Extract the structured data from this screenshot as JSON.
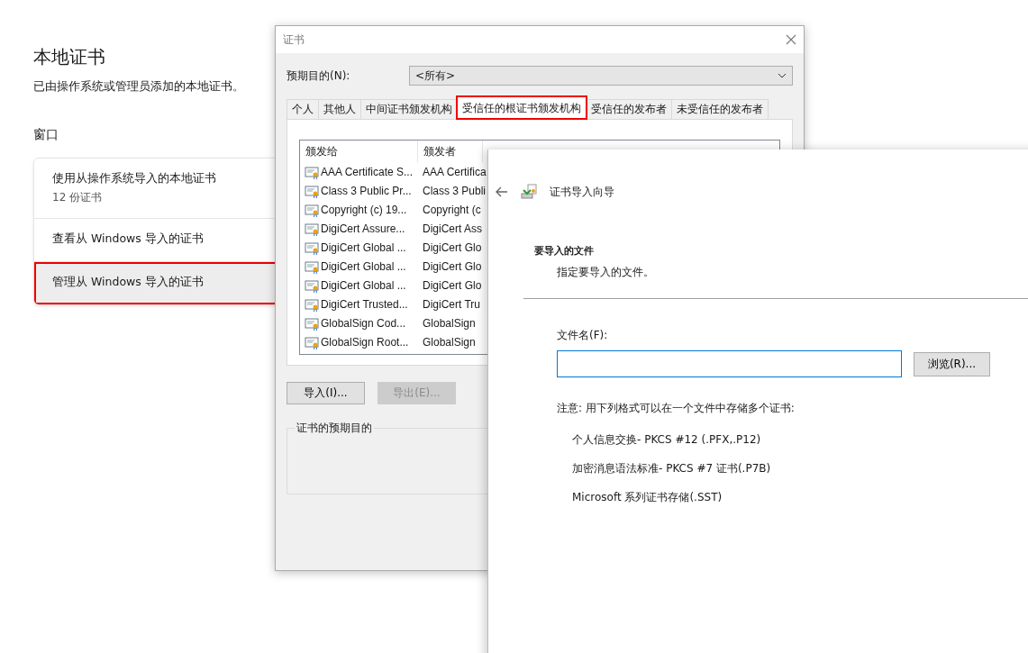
{
  "settings": {
    "title": "本地证书",
    "description": "已由操作系统或管理员添加的本地证书。",
    "section": "窗口",
    "items": [
      {
        "label": "使用从操作系统导入的本地证书",
        "sublabel": "12 份证书",
        "highlighted": false
      },
      {
        "label": "查看从 Windows 导入的证书",
        "highlighted": false
      },
      {
        "label": "管理从 Windows 导入的证书",
        "highlighted": true
      }
    ]
  },
  "cert_dialog": {
    "title": "证书",
    "purpose_label": "预期目的(N):",
    "purpose_value": "<所有>",
    "tabs": [
      {
        "label": "个人",
        "selected": false,
        "highlighted": false
      },
      {
        "label": "其他人",
        "selected": false,
        "highlighted": false
      },
      {
        "label": "中间证书颁发机构",
        "selected": false,
        "highlighted": false
      },
      {
        "label": "受信任的根证书颁发机构",
        "selected": true,
        "highlighted": true
      },
      {
        "label": "受信任的发布者",
        "selected": false,
        "highlighted": false
      },
      {
        "label": "未受信任的发布者",
        "selected": false,
        "highlighted": false
      }
    ],
    "columns": [
      "颁发给",
      "颁发者"
    ],
    "rows": [
      [
        "AAA Certificate S...",
        "AAA Certifica"
      ],
      [
        "Class 3 Public Pr...",
        "Class 3 Publi"
      ],
      [
        "Copyright (c) 19...",
        "Copyright (c"
      ],
      [
        "DigiCert Assure...",
        "DigiCert Ass"
      ],
      [
        "DigiCert Global ...",
        "DigiCert Glo"
      ],
      [
        "DigiCert Global ...",
        "DigiCert Glo"
      ],
      [
        "DigiCert Global ...",
        "DigiCert Glo"
      ],
      [
        "DigiCert Trusted...",
        "DigiCert Tru"
      ],
      [
        "GlobalSign Cod...",
        "GlobalSign"
      ],
      [
        "GlobalSign Root...",
        "GlobalSign"
      ]
    ],
    "buttons": [
      {
        "label": "导入(I)...",
        "disabled": false
      },
      {
        "label": "导出(E)...",
        "disabled": true
      }
    ],
    "group_label": "证书的预期目的"
  },
  "wizard": {
    "title": "证书导入向导",
    "heading": "要导入的文件",
    "subheading": "指定要导入的文件。",
    "file_label": "文件名(F):",
    "browse_button": "浏览(R)...",
    "note": "注意: 用下列格式可以在一个文件中存储多个证书:",
    "formats": [
      "个人信息交换- PKCS #12 (.PFX,.P12)",
      "加密消息语法标准- PKCS #7 证书(.P7B)",
      "Microsoft 系列证书存储(.SST)"
    ]
  }
}
